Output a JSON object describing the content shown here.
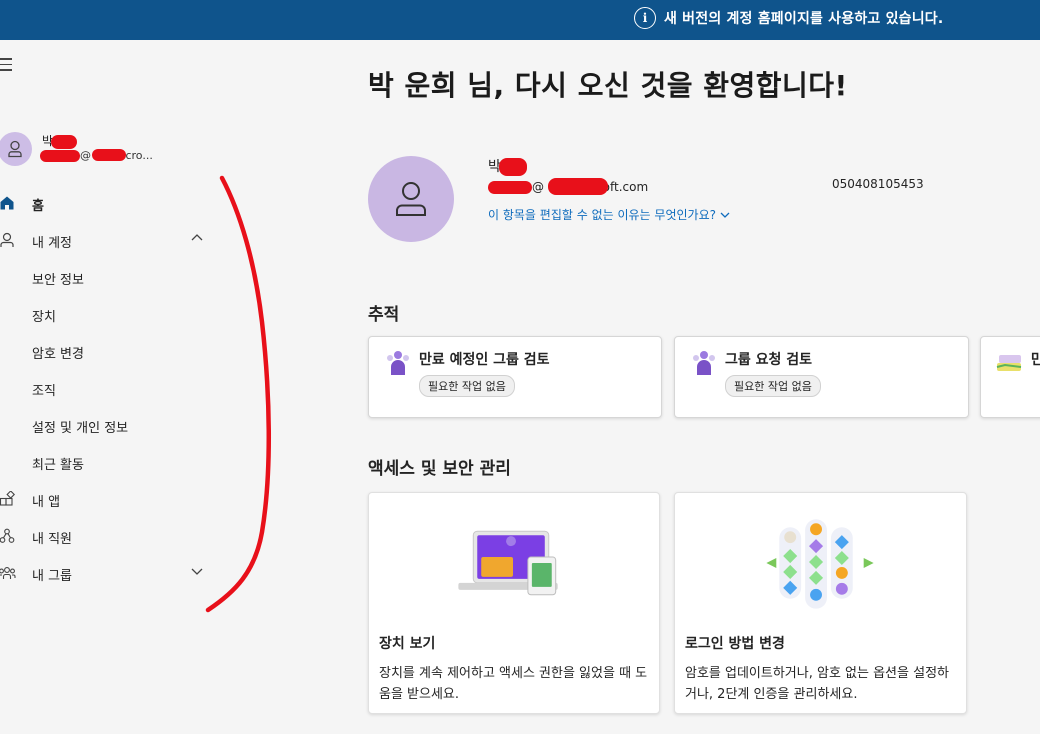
{
  "banner": {
    "text": "새 버전의 계정 홈페이지를 사용하고 있습니다.",
    "info_glyph": "i"
  },
  "sidebar": {
    "user": {
      "name": "박",
      "email": "@ .onmicro..."
    },
    "items": [
      {
        "label": "홈",
        "icon": "home-icon",
        "selected": true
      },
      {
        "label": "내 계정",
        "icon": "person-icon",
        "expanded": true
      },
      {
        "label": "보안 정보"
      },
      {
        "label": "장치"
      },
      {
        "label": "암호 변경"
      },
      {
        "label": "조직"
      },
      {
        "label": "설정 및 개인 정보"
      },
      {
        "label": "최근 활동"
      },
      {
        "label": "내 앱",
        "icon": "apps-icon"
      },
      {
        "label": "내 직원",
        "icon": "people-network-icon"
      },
      {
        "label": "내 그룹",
        "icon": "group-icon",
        "expanded": false
      }
    ]
  },
  "main": {
    "title": "박 운희 님, 다시 오신 것을 환영합니다!",
    "profile": {
      "name": "박",
      "email": "@ onmicrosoft.com",
      "edit_link": "이 항목을 편집할 수 없는 이유는 무엇인가요?",
      "phone": "050408105453"
    },
    "tracking": {
      "title": "추적",
      "cards": [
        {
          "title": "만료 예정인 그룹 검토",
          "badge": "필요한 작업 없음"
        },
        {
          "title": "그룹 요청 검토",
          "badge": "필요한 작업 없음"
        },
        {
          "title": "만",
          "badge": ""
        }
      ]
    },
    "access": {
      "title": "액세스 및 보안 관리",
      "cards": [
        {
          "title": "장치 보기",
          "desc": "장치를 계속 제어하고 액세스 권한을 잃었을 때 도움을 받으세요."
        },
        {
          "title": "로그인 방법 변경",
          "desc": "암호를 업데이트하거나, 암호 없는 옵션을 설정하거나, 2단계 인증을 관리하세요."
        }
      ]
    }
  },
  "colors": {
    "banner": "#0f548c",
    "accent": "#0f6cbd",
    "avatar": "#c9b7e3",
    "annotation": "#e8101a"
  }
}
